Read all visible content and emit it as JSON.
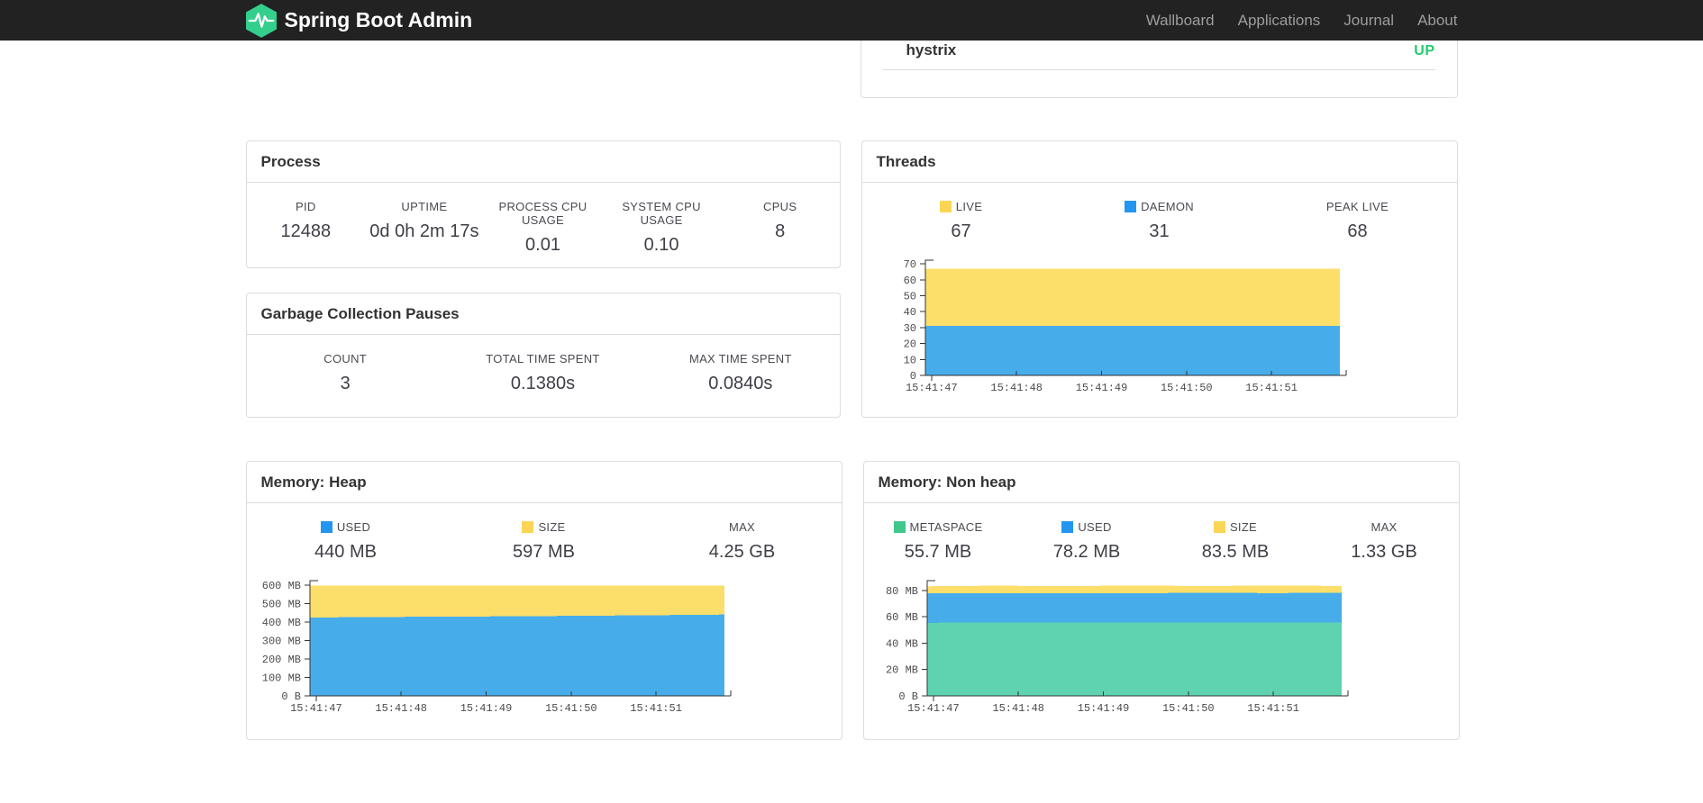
{
  "navbar": {
    "brand": "Spring Boot Admin",
    "links": [
      {
        "label": "Wallboard"
      },
      {
        "label": "Applications"
      },
      {
        "label": "Journal"
      },
      {
        "label": "About"
      }
    ],
    "colors": {
      "bg": "#222222",
      "link": "#9d9d9d",
      "brand": "#ffffff",
      "logo_green": "#34ce8d"
    }
  },
  "status_card": {
    "application": "hystrix",
    "status": "UP",
    "status_color": "#24cc6d"
  },
  "cards": {
    "process": {
      "title": "Process",
      "metrics": [
        {
          "label": "PID",
          "value": "12488"
        },
        {
          "label": "UPTIME",
          "value": "0d 0h 2m 17s"
        },
        {
          "label": "PROCESS CPU USAGE",
          "value": "0.01"
        },
        {
          "label": "SYSTEM CPU USAGE",
          "value": "0.10"
        },
        {
          "label": "CPUS",
          "value": "8"
        }
      ]
    },
    "gc": {
      "title": "Garbage Collection Pauses",
      "metrics": [
        {
          "label": "COUNT",
          "value": "3"
        },
        {
          "label": "TOTAL TIME SPENT",
          "value": "0.1380s"
        },
        {
          "label": "MAX TIME SPENT",
          "value": "0.0840s"
        }
      ]
    },
    "threads": {
      "title": "Threads",
      "metrics": [
        {
          "label": "LIVE",
          "value": "67",
          "swatch": "#fcd555"
        },
        {
          "label": "DAEMON",
          "value": "31",
          "swatch": "#2296f0"
        },
        {
          "label": "PEAK LIVE",
          "value": "68"
        }
      ]
    },
    "heap": {
      "title": "Memory: Heap",
      "metrics": [
        {
          "label": "USED",
          "value": "440 MB",
          "swatch": "#2296f0"
        },
        {
          "label": "SIZE",
          "value": "597 MB",
          "swatch": "#fcd555"
        },
        {
          "label": "MAX",
          "value": "4.25 GB"
        }
      ]
    },
    "nonheap": {
      "title": "Memory: Non heap",
      "metrics": [
        {
          "label": "METASPACE",
          "value": "55.7 MB",
          "swatch": "#41c78c"
        },
        {
          "label": "USED",
          "value": "78.2 MB",
          "swatch": "#2296f0"
        },
        {
          "label": "SIZE",
          "value": "83.5 MB",
          "swatch": "#fcd555"
        },
        {
          "label": "MAX",
          "value": "1.33 GB"
        }
      ]
    }
  },
  "chart_data": [
    {
      "id": "threads",
      "type": "area",
      "stacked": false,
      "title": "Threads",
      "legend_position": "top",
      "grid": false,
      "x_ticks": [
        "15:41:47",
        "15:41:48",
        "15:41:49",
        "15:41:50",
        "15:41:51"
      ],
      "x_tick_fractions": [
        0.015,
        0.22,
        0.425,
        0.63,
        0.835
      ],
      "y_ticks": [
        {
          "label": "0",
          "value": 0
        },
        {
          "label": "10",
          "value": 10
        },
        {
          "label": "20",
          "value": 20
        },
        {
          "label": "30",
          "value": 30
        },
        {
          "label": "40",
          "value": 40
        },
        {
          "label": "50",
          "value": 50
        },
        {
          "label": "60",
          "value": 60
        },
        {
          "label": "70",
          "value": 70
        }
      ],
      "ylim": [
        0,
        72.3
      ],
      "series": [
        {
          "name": "LIVE",
          "color": "#fcde6b",
          "values": [
            67,
            67,
            67,
            67,
            67,
            67
          ]
        },
        {
          "name": "DAEMON",
          "color": "#47adea",
          "values": [
            31,
            31,
            31,
            31,
            31,
            31
          ]
        }
      ]
    },
    {
      "id": "memory-heap",
      "type": "area",
      "stacked": false,
      "title": "Memory: Heap",
      "legend_position": "top",
      "grid": false,
      "x_ticks": [
        "15:41:47",
        "15:41:48",
        "15:41:49",
        "15:41:50",
        "15:41:51"
      ],
      "x_tick_fractions": [
        0.015,
        0.22,
        0.425,
        0.63,
        0.835
      ],
      "y_ticks": [
        {
          "label": "0 B",
          "value": 0
        },
        {
          "label": "100 MB",
          "value": 100
        },
        {
          "label": "200 MB",
          "value": 200
        },
        {
          "label": "300 MB",
          "value": 300
        },
        {
          "label": "400 MB",
          "value": 400
        },
        {
          "label": "500 MB",
          "value": 500
        },
        {
          "label": "600 MB",
          "value": 600
        }
      ],
      "ylim": [
        0,
        624
      ],
      "y_unit": "MB",
      "series": [
        {
          "name": "SIZE",
          "color": "#fcde6b",
          "values": [
            597,
            597,
            597,
            597,
            597,
            597,
            597
          ]
        },
        {
          "name": "USED",
          "color": "#47adea",
          "values": [
            424,
            427,
            429,
            431,
            434,
            437,
            440
          ]
        }
      ]
    },
    {
      "id": "memory-nonheap",
      "type": "area",
      "stacked": false,
      "title": "Memory: Non heap",
      "legend_position": "top",
      "grid": false,
      "x_ticks": [
        "15:41:47",
        "15:41:48",
        "15:41:49",
        "15:41:50",
        "15:41:51"
      ],
      "x_tick_fractions": [
        0.015,
        0.22,
        0.425,
        0.63,
        0.835
      ],
      "y_ticks": [
        {
          "label": "0 B",
          "value": 0
        },
        {
          "label": "20 MB",
          "value": 20
        },
        {
          "label": "40 MB",
          "value": 40
        },
        {
          "label": "60 MB",
          "value": 60
        },
        {
          "label": "80 MB",
          "value": 80
        }
      ],
      "ylim": [
        0,
        87.5
      ],
      "y_unit": "MB",
      "series": [
        {
          "name": "SIZE",
          "color": "#fcde6b",
          "values": [
            83.2,
            83.7,
            83.3,
            83.8,
            83.4,
            83.8,
            83.5
          ]
        },
        {
          "name": "USED",
          "color": "#47adea",
          "values": [
            77.8,
            78.0,
            78.1,
            78.0,
            78.2,
            78.1,
            78.2
          ]
        },
        {
          "name": "METASPACE",
          "color": "#5fd3af",
          "values": [
            55.5,
            55.7,
            55.6,
            55.7,
            55.7,
            55.8,
            55.7
          ]
        }
      ]
    }
  ]
}
